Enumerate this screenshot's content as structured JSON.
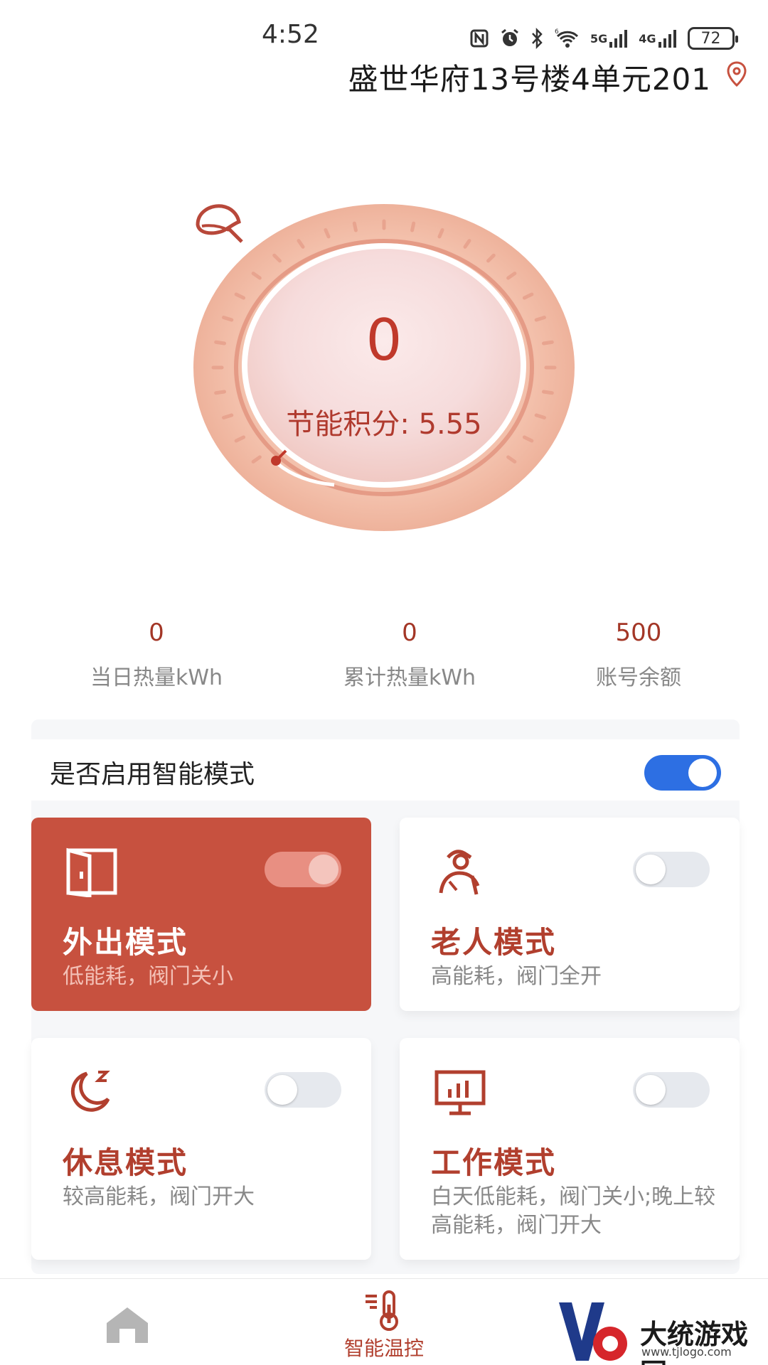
{
  "status_bar": {
    "time": "4:52",
    "icons": [
      "nfc-icon",
      "alarm-icon",
      "bluetooth-icon",
      "wifi-icon",
      "signal-5g-icon",
      "signal-4g-icon"
    ],
    "net1": "5G",
    "net2": "4G",
    "wifi_tag": "6",
    "battery": "72"
  },
  "header": {
    "title": "盛世华府13号楼4单元201"
  },
  "dial": {
    "value": "0",
    "score_label": "节能积分: 5.55",
    "level_fraction": 0.0
  },
  "stats": [
    {
      "value": "0",
      "label": "当日热量kWh"
    },
    {
      "value": "0",
      "label": "累计热量kWh"
    },
    {
      "value": "500",
      "label": "账号余额"
    }
  ],
  "smart_mode": {
    "label": "是否启用智能模式",
    "enabled": true
  },
  "modes": [
    {
      "title": "外出模式",
      "desc": "低能耗，阀门关小",
      "active": true,
      "icon": "door-icon"
    },
    {
      "title": "老人模式",
      "desc": "高能耗，阀门全开",
      "active": false,
      "icon": "elderly-icon"
    },
    {
      "title": "休息模式",
      "desc": "较高能耗，阀门开大",
      "active": false,
      "icon": "moon-sleep-icon"
    },
    {
      "title": "工作模式",
      "desc": "白天低能耗，阀门关小;晚上较高能耗，阀门开大",
      "active": false,
      "icon": "monitor-icon"
    }
  ],
  "bottom_nav": {
    "items": [
      {
        "label": "",
        "icon": "home-icon"
      },
      {
        "label": "智能温控",
        "icon": "thermometer-icon"
      }
    ]
  },
  "watermark": {
    "text": "大统游戏园",
    "url": "www.tjlogo.com"
  },
  "colors": {
    "accent": "#c7513f",
    "switch_on": "#2d6fe3",
    "value_red": "#c0392b"
  }
}
